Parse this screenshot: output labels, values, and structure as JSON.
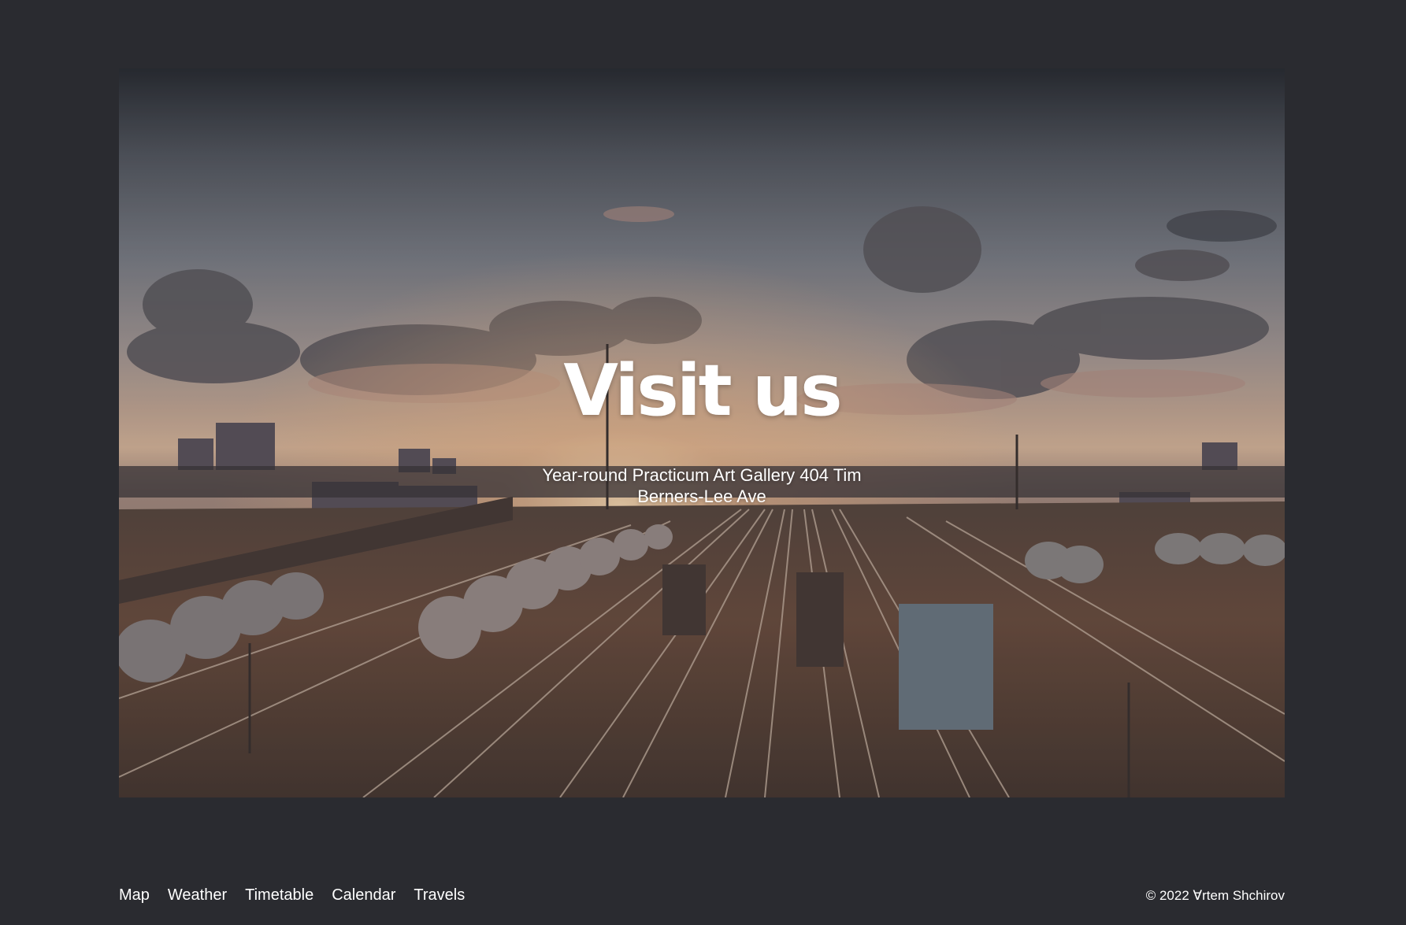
{
  "hero": {
    "title": "Visit us",
    "subtitle": "Year-round Practicum Art Gallery 404 Tim Berners-Lee Ave",
    "image_description_icon": "railway-sunset-photo"
  },
  "footer": {
    "nav": [
      {
        "label": "Map"
      },
      {
        "label": "Weather"
      },
      {
        "label": "Timetable"
      },
      {
        "label": "Calendar"
      },
      {
        "label": "Travels"
      }
    ],
    "copyright": "© 2022 Ɐrtem Shchirov"
  },
  "colors": {
    "page_background": "#2a2b30",
    "text": "#ffffff"
  }
}
